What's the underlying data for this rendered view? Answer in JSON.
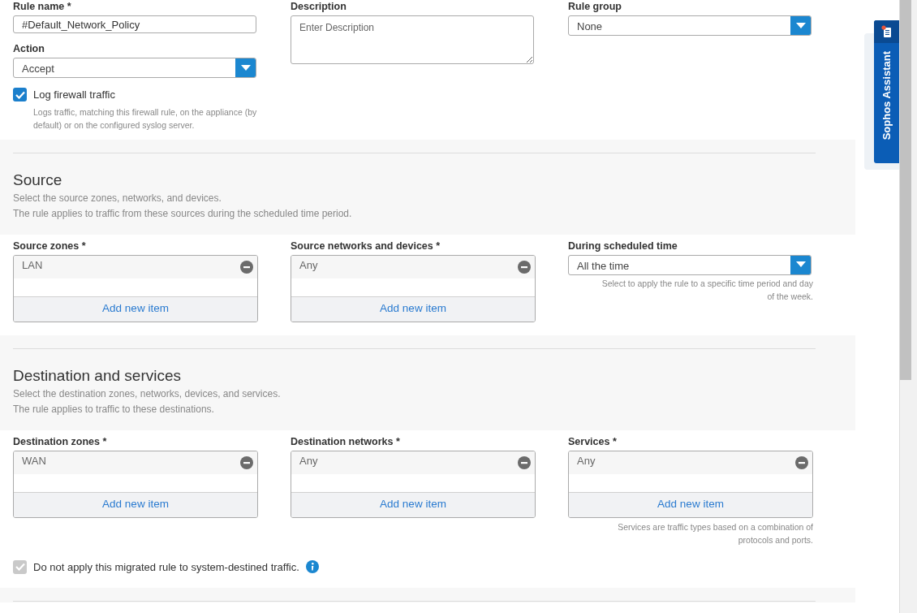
{
  "form_top": {
    "columns": [
      [
        {
          "kind": "text",
          "label": "Rule name *",
          "value": "#Default_Network_Policy"
        },
        {
          "kind": "select",
          "label": "Action",
          "value": "Accept"
        },
        {
          "kind": "checkbox",
          "label": "Log firewall traffic",
          "checked": true,
          "disabled": false,
          "help": "Logs traffic, matching this firewall rule, on the appliance (by default) or on the configured syslog server."
        }
      ],
      [
        {
          "kind": "textarea",
          "label": "Description",
          "placeholder": "Enter Description"
        }
      ],
      [
        {
          "kind": "select",
          "label": "Rule group",
          "value": "None"
        }
      ]
    ]
  },
  "sections": [
    {
      "title": "Source",
      "lines": [
        "Select the source zones, networks, and devices.",
        "The rule applies to traffic from these sources during the scheduled time period."
      ],
      "columns": [
        [
          {
            "kind": "list",
            "label": "Source zones *",
            "items": [
              "LAN"
            ],
            "add_label": "Add new item"
          }
        ],
        [
          {
            "kind": "list",
            "label": "Source networks and devices *",
            "items": [
              "Any"
            ],
            "add_label": "Add new item"
          }
        ],
        [
          {
            "kind": "select",
            "label": "During scheduled time",
            "value": "All the time",
            "help": "Select to apply the rule to a specific time period and day of the week."
          }
        ]
      ]
    },
    {
      "title": "Destination and services",
      "lines": [
        "Select the destination zones, networks, devices, and services.",
        "The rule applies to traffic to these destinations."
      ],
      "columns": [
        [
          {
            "kind": "list",
            "label": "Destination zones *",
            "items": [
              "WAN"
            ],
            "add_label": "Add new item"
          }
        ],
        [
          {
            "kind": "list",
            "label": "Destination networks *",
            "items": [
              "Any"
            ],
            "add_label": "Add new item"
          }
        ],
        [
          {
            "kind": "list",
            "label": "Services *",
            "items": [
              "Any"
            ],
            "add_label": "Add new item",
            "help": "Services are traffic types based on a combination of protocols and ports."
          }
        ]
      ],
      "footer": [
        {
          "kind": "checkbox",
          "label": "Do not apply this migrated rule to system-destined traffic.",
          "checked": true,
          "disabled": true,
          "info": true
        }
      ]
    }
  ],
  "assistant": {
    "label": "Sophos Assistant"
  }
}
